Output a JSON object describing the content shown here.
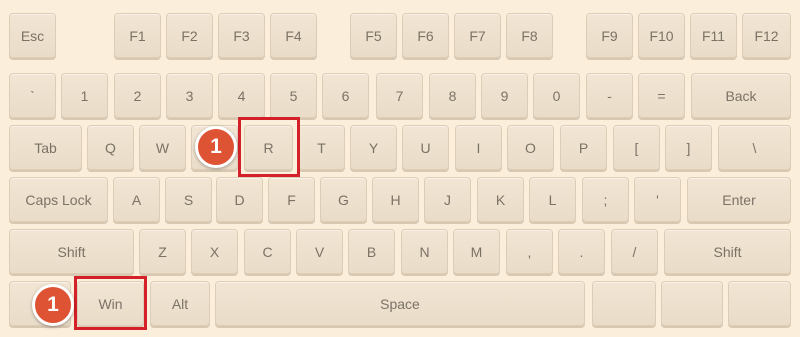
{
  "colors": {
    "background": "#fbeedb",
    "key_fill": "#efe2cf",
    "key_text": "#7b7266",
    "highlight_border": "#d42028",
    "badge_fill": "#dd5333",
    "badge_text": "#ffffff"
  },
  "function_row": {
    "esc": "Esc",
    "f1": "F1",
    "f2": "F2",
    "f3": "F3",
    "f4": "F4",
    "f5": "F5",
    "f6": "F6",
    "f7": "F7",
    "f8": "F8",
    "f9": "F9",
    "f10": "F10",
    "f11": "F11",
    "f12": "F12"
  },
  "number_row": {
    "backtick": "`",
    "k1": "1",
    "k2": "2",
    "k3": "3",
    "k4": "4",
    "k5": "5",
    "k6": "6",
    "k7": "7",
    "k8": "8",
    "k9": "9",
    "k0": "0",
    "minus": "-",
    "equals": "=",
    "back": "Back"
  },
  "top_row": {
    "tab": "Tab",
    "q": "Q",
    "w": "W",
    "r": "R",
    "t": "T",
    "y": "Y",
    "u": "U",
    "i": "I",
    "o": "O",
    "p": "P",
    "lbracket": "[",
    "rbracket": "]",
    "backslash": "\\"
  },
  "home_row": {
    "caps": "Caps Lock",
    "a": "A",
    "s": "S",
    "d": "D",
    "f": "F",
    "g": "G",
    "h": "H",
    "j": "J",
    "k": "K",
    "l": "L",
    "semicolon": ";",
    "quote": "'",
    "enter": "Enter"
  },
  "bottom_row": {
    "shift_left": "Shift",
    "z": "Z",
    "x": "X",
    "c": "C",
    "v": "V",
    "b": "B",
    "n": "N",
    "m": "M",
    "comma": ",",
    "period": ".",
    "slash": "/",
    "shift_right": "Shift"
  },
  "space_row": {
    "win": "Win",
    "alt": "Alt",
    "space": "Space"
  },
  "annotations": {
    "step_r": "1",
    "step_win": "1"
  }
}
